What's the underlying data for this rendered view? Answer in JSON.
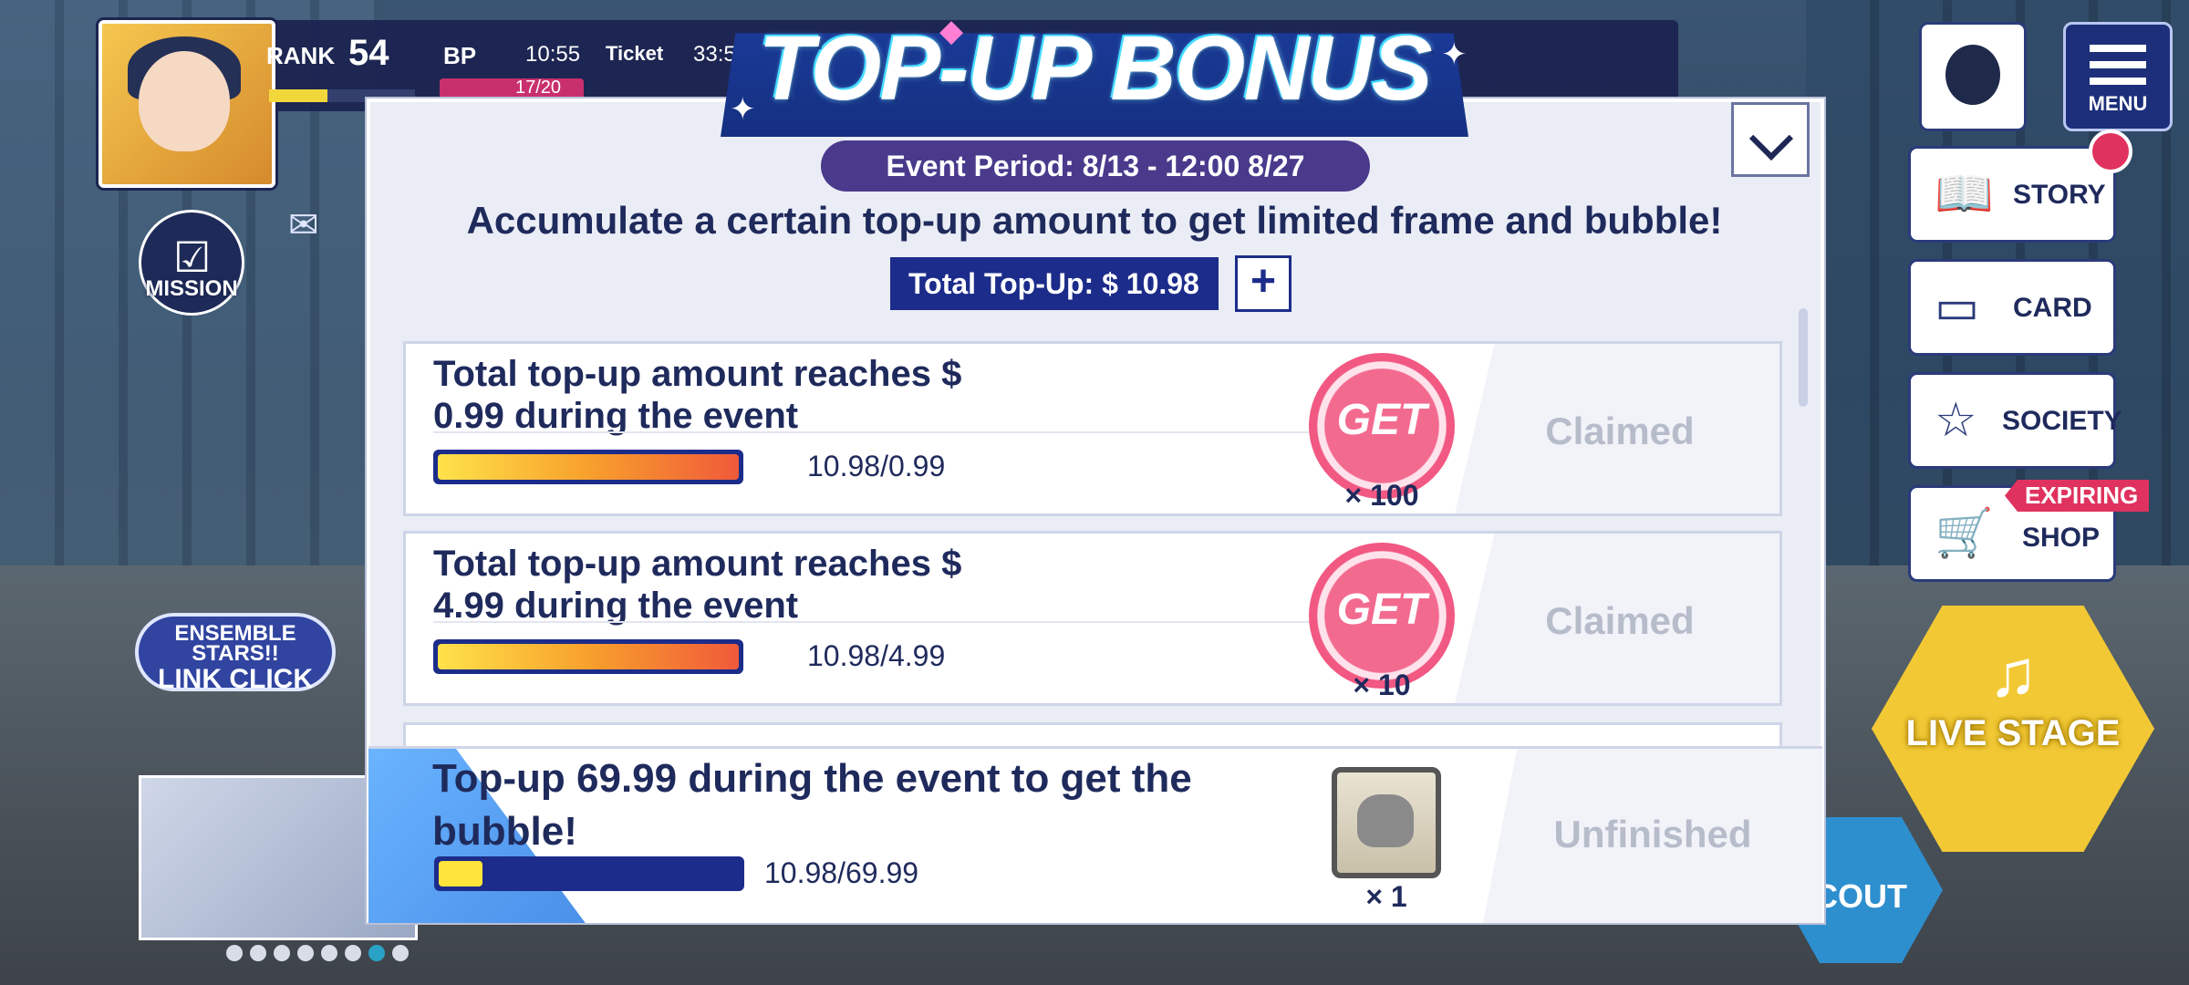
{
  "hud": {
    "rank_label": "RANK",
    "rank_value": "54",
    "rank_progress": 0.4,
    "bp_label": "BP",
    "bp_time": "10:55",
    "bp_count": "17/20",
    "ticket_label": "Ticket",
    "ticket_time": "33:5"
  },
  "left": {
    "mission_label": "MISSION",
    "link_click_line1": "ENSEMBLE STARS!!",
    "link_click_line2": "LINK CLICK",
    "carousel_count": 8,
    "carousel_active": 7
  },
  "right": {
    "menu_label": "MENU",
    "story_label": "STORY",
    "card_label": "CARD",
    "society_label": "SOCIETY",
    "shop_label": "SHOP",
    "expiring_label": "EXPIRING",
    "live_stage_label": "LIVE STAGE",
    "scout_label": "COUT"
  },
  "dialog": {
    "title": "TOP-UP BONUS",
    "event_period": "Event Period: 8/13 - 12:00 8/27",
    "subtitle": "Accumulate a certain top-up amount to get limited frame and bubble!",
    "total_topup": "Total Top-Up: $ 10.98",
    "plus_label": "+",
    "tasks": [
      {
        "description": "Total top-up amount reaches $ 0.99 during the event",
        "progress_text": "10.98/0.99",
        "progress": 1.0,
        "reward_label": "GET",
        "reward_qty": "× 100",
        "status": "Claimed"
      },
      {
        "description": "Total top-up amount reaches $ 4.99 during the event",
        "progress_text": "10.98/4.99",
        "progress": 1.0,
        "reward_label": "GET",
        "reward_qty": "× 10",
        "status": "Claimed"
      }
    ],
    "bubble_task": {
      "description": "Top-up 69.99 during the event to get the bubble!",
      "progress_text": "10.98/69.99",
      "progress": 0.157,
      "reward_qty": "× 1",
      "status": "Unfinished"
    }
  }
}
